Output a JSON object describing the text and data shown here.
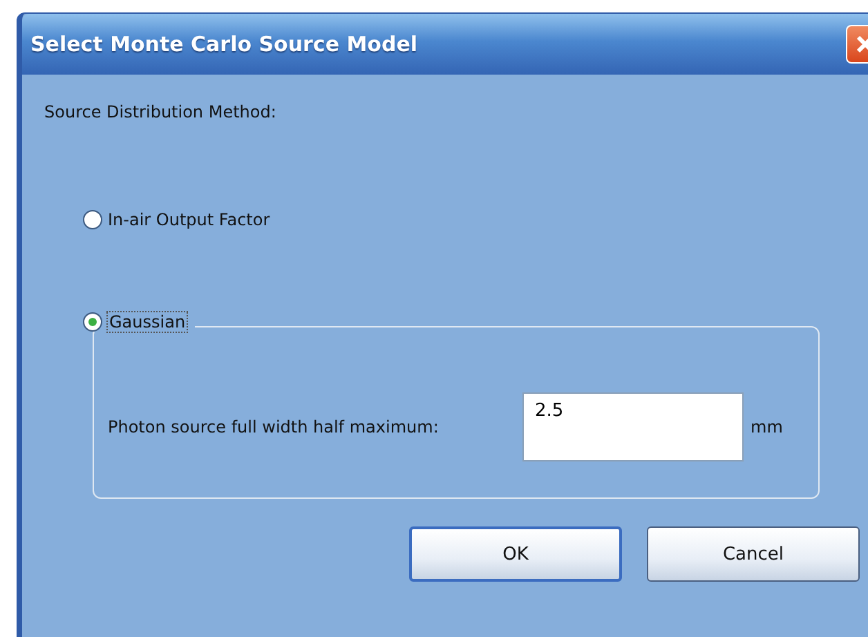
{
  "window": {
    "title": "Select Monte Carlo Source Model"
  },
  "section_label": "Source Distribution Method:",
  "options": [
    {
      "label": "In-air Output Factor",
      "selected": false
    },
    {
      "label": "Gaussian",
      "selected": true
    }
  ],
  "gaussian": {
    "label": "Photon source full width half maximum:",
    "value": "2.5",
    "unit": "mm"
  },
  "buttons": [
    {
      "label": "OK",
      "default": true
    },
    {
      "label": "Cancel",
      "default": false
    }
  ]
}
